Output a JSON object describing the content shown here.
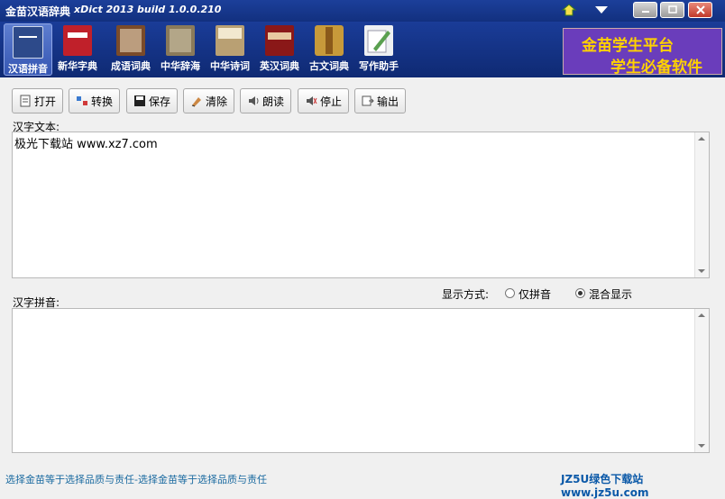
{
  "window": {
    "app_title": "金苗汉语辞典",
    "version": "xDict 2013  build 1.0.0.210"
  },
  "nav": {
    "items": [
      {
        "label": "汉语拼音",
        "active": true,
        "color": "#2d4a8a"
      },
      {
        "label": "新华字典",
        "active": false,
        "color": "#c0202a"
      },
      {
        "label": "成语词典",
        "active": false,
        "color": "#7a4b2a"
      },
      {
        "label": "中华辞海",
        "active": false,
        "color": "#8a7a5a"
      },
      {
        "label": "中华诗词",
        "active": false,
        "color": "#b9a073"
      },
      {
        "label": "英汉词典",
        "active": false,
        "color": "#8a1818"
      },
      {
        "label": "古文词典",
        "active": false,
        "color": "#c79a3a"
      },
      {
        "label": "写作助手",
        "active": false,
        "color": "#5aa050"
      }
    ]
  },
  "banner": {
    "line1": "金苗学生平台",
    "line2": "学生必备软件"
  },
  "actions": {
    "open": "打开",
    "convert": "转换",
    "save": "保存",
    "clear": "清除",
    "read": "朗读",
    "stop": "停止",
    "output": "输出"
  },
  "hanzi": {
    "label": "汉字文本:",
    "value": "极光下载站 www.xz7.com"
  },
  "pinyin": {
    "label": "汉字拼音:",
    "display_mode_label": "显示方式:",
    "option_pinyin_only": "仅拼音",
    "option_mixed": "混合显示",
    "selected": "混合显示"
  },
  "status": {
    "left": "选择金苗等于选择品质与责任-选择金苗等于选择品质与责任",
    "right": "JZ5U绿色下载站www.jz5u.com"
  },
  "colors": {
    "titlebar": "#12307f",
    "banner_bg": "#6a3dbb",
    "banner_text": "#ffd200"
  }
}
